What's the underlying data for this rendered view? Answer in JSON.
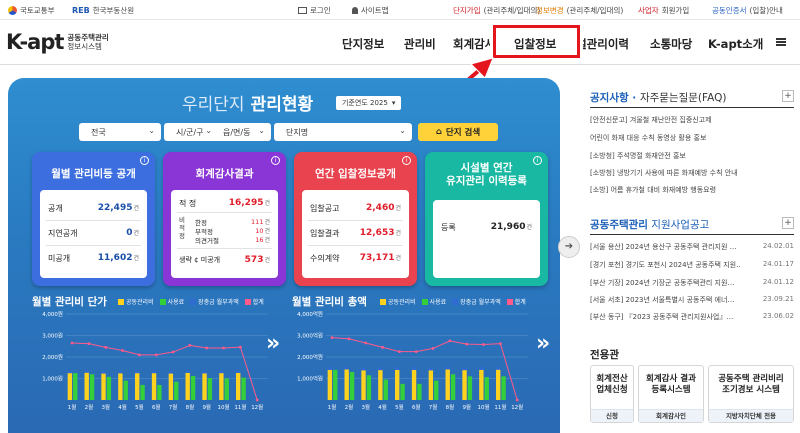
{
  "topbar": {
    "org1": "국토교통부",
    "org2": "한국부동산원",
    "login": "로그인",
    "sitemap": "사이트맵",
    "links": [
      {
        "key": "단지가입",
        "rest": "(관리주체/입대의)"
      },
      {
        "key": "정보변경",
        "rest": "(관리주체/입대의)"
      },
      {
        "key": "사업자",
        "rest": " 회원가입"
      },
      {
        "key": "공동인증서",
        "rest": "(입찰)안내"
      }
    ]
  },
  "header": {
    "logo_main": "K-apt",
    "logo_sub1": "공동주택관리",
    "logo_sub2": "정보시스템",
    "nav": [
      "단지정보",
      "관리비",
      "회계감사",
      "입찰정보",
      "시설관리이력",
      "소통마당",
      "K-apt소개"
    ]
  },
  "panel": {
    "title_thin": "우리단지",
    "title_bold": "관리현황",
    "year_label": "기준연도 2025",
    "filters": [
      "전국",
      "시/군/구",
      "읍/면/동",
      "단지명"
    ],
    "search_button": "단지 검색"
  },
  "cards": {
    "fee": {
      "title": "월별 관리비등 공개",
      "rows": [
        {
          "label": "공개",
          "value": "22,495",
          "unit": "건"
        },
        {
          "label": "지연공개",
          "value": "0",
          "unit": "건"
        },
        {
          "label": "미공개",
          "value": "11,602",
          "unit": "건"
        }
      ]
    },
    "audit": {
      "title": "회계감사결과",
      "total_label": "적 정",
      "total_value": "16,295",
      "sub_group_label": "비적정",
      "sub_rows": [
        {
          "label": "한정",
          "value": "111"
        },
        {
          "label": "부적정",
          "value": "10"
        },
        {
          "label": "의견거절",
          "value": "16"
        }
      ],
      "sub_unit": "건",
      "omit_label": "생략 ¢ 미공개",
      "omit_value": "573",
      "unit": "건"
    },
    "bid": {
      "title": "연간 입찰정보공개",
      "rows": [
        {
          "label": "입찰공고",
          "value": "2,460",
          "unit": "건"
        },
        {
          "label": "입찰결과",
          "value": "12,653",
          "unit": "건"
        },
        {
          "label": "수의계약",
          "value": "73,171",
          "unit": "건"
        }
      ]
    },
    "facility": {
      "title1": "시설별 연간",
      "title2": "유지관리 이력등록",
      "row": {
        "label": "등록",
        "value": "21,960",
        "unit": "건"
      }
    }
  },
  "colors": {
    "card_blue": "#3c6ee0",
    "card_purple": "#8a35d6",
    "card_red": "#e8434f",
    "card_teal": "#19b8a2",
    "fee_yellow": "#ffd21f",
    "use_green": "#34d03a",
    "reserve_blue": "#2f6bd1",
    "total_pink": "#ff5a8a"
  },
  "legend": [
    "공동관리비",
    "사용료",
    "장충금 월부과액",
    "합계"
  ],
  "chart_data": [
    {
      "type": "bar",
      "title": "월별 관리비 단가",
      "categories": [
        "1월",
        "2월",
        "3월",
        "4월",
        "5월",
        "6월",
        "7월",
        "8월",
        "9월",
        "10월",
        "11월",
        "12월"
      ],
      "y_ticks": [
        "4,000원",
        "3,000원",
        "2,000원",
        "1,000원"
      ],
      "ylim": [
        0,
        4000
      ],
      "series": [
        {
          "name": "공동관리비",
          "values": [
            1250,
            1270,
            1230,
            1240,
            1250,
            1250,
            1230,
            1260,
            1240,
            1250,
            1260,
            0
          ]
        },
        {
          "name": "사용료",
          "values": [
            1250,
            1200,
            1080,
            900,
            700,
            700,
            850,
            1120,
            1020,
            1000,
            1040,
            0
          ]
        },
        {
          "name": "장충금 월부과액",
          "values": [
            110,
            110,
            110,
            110,
            110,
            110,
            110,
            110,
            110,
            110,
            110,
            0
          ]
        },
        {
          "name": "합계",
          "values": [
            2650,
            2620,
            2450,
            2300,
            2100,
            2100,
            2230,
            2540,
            2420,
            2420,
            2460,
            0
          ]
        }
      ]
    },
    {
      "type": "bar",
      "title": "월별 관리비 총액",
      "categories": [
        "1월",
        "2월",
        "3월",
        "4월",
        "5월",
        "6월",
        "7월",
        "8월",
        "9월",
        "10월",
        "11월",
        "12월"
      ],
      "y_ticks": [
        "4,000억원",
        "3,000억원",
        "2,000억원",
        "1,000억원"
      ],
      "ylim": [
        0,
        4000
      ],
      "series": [
        {
          "name": "공동관리비",
          "values": [
            1400,
            1420,
            1380,
            1390,
            1400,
            1400,
            1380,
            1420,
            1390,
            1400,
            1410,
            0
          ]
        },
        {
          "name": "사용료",
          "values": [
            1400,
            1300,
            1150,
            950,
            750,
            750,
            900,
            1200,
            1100,
            1060,
            1100,
            0
          ]
        },
        {
          "name": "장충금 월부과액",
          "values": [
            120,
            120,
            120,
            120,
            120,
            120,
            120,
            120,
            120,
            120,
            120,
            0
          ]
        },
        {
          "name": "합계",
          "values": [
            2900,
            2850,
            2650,
            2450,
            2250,
            2250,
            2400,
            2750,
            2600,
            2580,
            2620,
            0
          ]
        }
      ]
    }
  ],
  "sidebar": {
    "notice_title": "공지사항",
    "notice_title2": "자주묻는질문(FAQ)",
    "notices": [
      "[안전신문고] 겨울철 재난안전 집중신고제",
      "어린이 화재 대응 수칙 동영상 활용 홍보",
      "[소방청] 주석명절 화재안전 홍보",
      "[소방청] 냉방기기 사용에 따른 화재예방 수칙 안내",
      "[소방] 어름 휴가철 대비 화재예방 행동요령"
    ],
    "support_title_a": "공동주택관리",
    "support_title_b": " 지원사업공고",
    "support": [
      {
        "text": "[서울 용산] 2024년 용산구 공동주택 관리지원 …",
        "date": "24.02.01"
      },
      {
        "text": "[경기 포천] 경기도 포천시 2024년 공동주택 지원…",
        "date": "24.01.17"
      },
      {
        "text": "[부산 기장] 2024년 기장군 공동주택관리 지원…",
        "date": "24.01.12"
      },
      {
        "text": "[서울 서초] 2023년 서울특별시 공동주택 에너…",
        "date": "23.09.21"
      },
      {
        "text": "[부산 동구] 『2023 공동주택 관리지원사업』…",
        "date": "23.06.02"
      }
    ],
    "dedicated_title": "전용관",
    "services": [
      {
        "t1": "회계전산",
        "t2": "업체신청",
        "b": "신청"
      },
      {
        "t1": "회계감사 결과",
        "t2": "등록시스템",
        "b": "회계감사인"
      },
      {
        "t1": "공동주택 관리비리",
        "t2": "조기경보 시스템",
        "b": "지방자치단체 전용"
      }
    ]
  }
}
